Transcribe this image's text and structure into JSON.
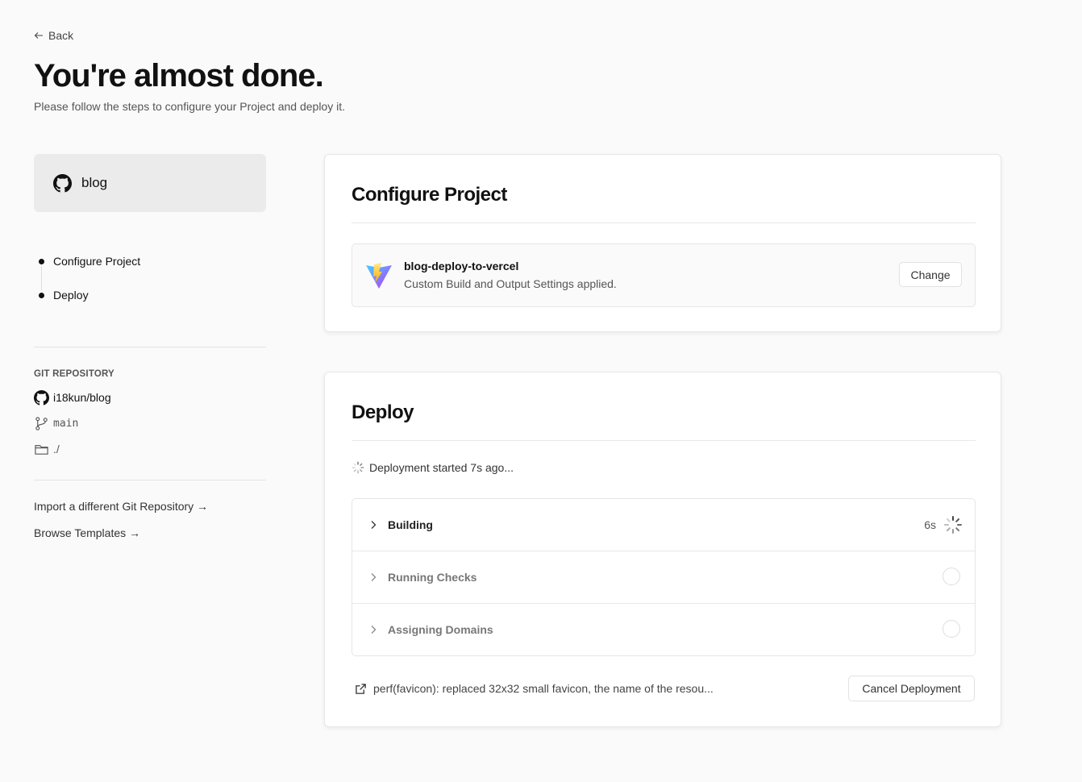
{
  "back": {
    "label": "Back"
  },
  "header": {
    "title": "You're almost done.",
    "subtitle": "Please follow the steps to configure your Project and deploy it."
  },
  "sidebar": {
    "repo_name": "blog",
    "steps": [
      {
        "label": "Configure Project"
      },
      {
        "label": "Deploy"
      }
    ],
    "git": {
      "heading": "GIT REPOSITORY",
      "repo": "i18kun/blog",
      "branch": "main",
      "root": "./"
    },
    "links": [
      {
        "label": "Import a different Git Repository →"
      },
      {
        "label": "Browse Templates →"
      }
    ]
  },
  "configure": {
    "title": "Configure Project",
    "preset": {
      "name": "blog-deploy-to-vercel",
      "description": "Custom Build and Output Settings applied."
    },
    "change_label": "Change"
  },
  "deploy": {
    "title": "Deploy",
    "status": "Deployment started 7s ago...",
    "steps": [
      {
        "label": "Building",
        "time": "6s",
        "state": "active",
        "color": "#222222"
      },
      {
        "label": "Running Checks",
        "time": "",
        "state": "pending",
        "color": "#777777"
      },
      {
        "label": "Assigning Domains",
        "time": "",
        "state": "pending",
        "color": "#777777"
      }
    ],
    "commit_message": "perf(favicon): replaced 32x32 small favicon, the name of the resou...",
    "cancel_label": "Cancel Deployment"
  },
  "colors": {
    "background": "#fafafa",
    "text": "#111111",
    "muted": "#555555",
    "border": "#e6e6e6"
  }
}
